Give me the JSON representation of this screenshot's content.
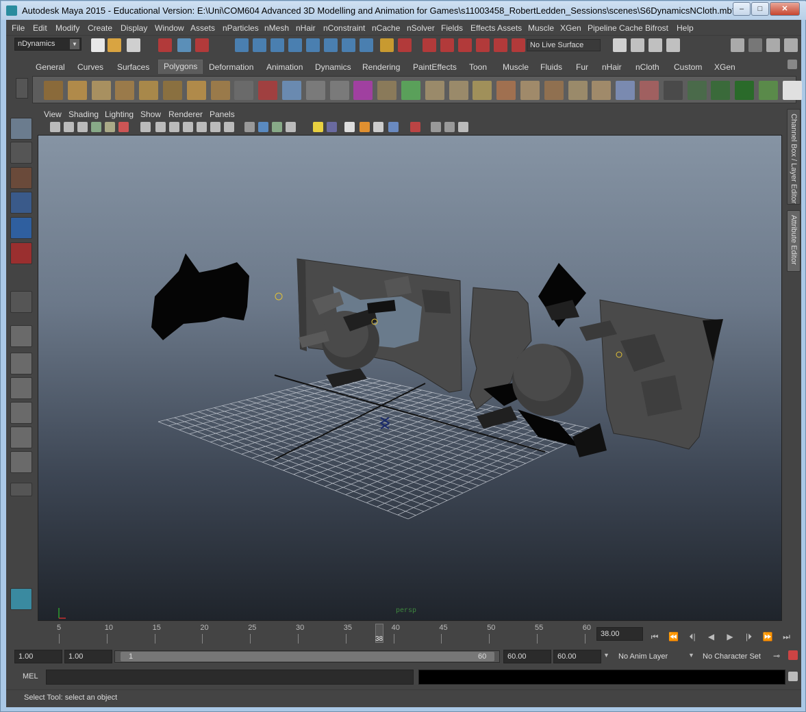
{
  "window": {
    "title": "Autodesk Maya 2015 - Educational Version: E:\\Uni\\COM604 Advanced 3D Modelling and Animation for Games\\s11003458_RobertLedden_Sessions\\scenes\\S6DynamicsNCloth.mb*",
    "minimize": "–",
    "maximize": "□",
    "close": "✕"
  },
  "menubar": {
    "items": [
      "File",
      "Edit",
      "Modify",
      "Create",
      "Display",
      "Window",
      "Assets",
      "nParticles",
      "nMesh",
      "nHair",
      "nConstraint",
      "nCache",
      "nSolver",
      "Fields",
      "Effects Assets",
      "Muscle",
      "XGen",
      "Pipeline Cache",
      "Bifrost",
      "Help"
    ]
  },
  "statusline": {
    "mode": "nDynamics",
    "live_surface": "No Live Surface"
  },
  "shelf": {
    "tabs": [
      "General",
      "Curves",
      "Surfaces",
      "Polygons",
      "Deformation",
      "Animation",
      "Dynamics",
      "Rendering",
      "PaintEffects",
      "Toon",
      "Muscle",
      "Fluids",
      "Fur",
      "nHair",
      "nCloth",
      "Custom",
      "XGen"
    ],
    "active_tab": "Polygons",
    "icons": [
      "poly-sphere-icon",
      "poly-cube-icon",
      "poly-cylinder-icon",
      "poly-cone-icon",
      "poly-plane-icon",
      "poly-torus-icon",
      "poly-pyramid-icon",
      "poly-pipe-icon",
      "poly-soccer-ball-icon",
      "combine-icon",
      "separate-icon",
      "extract-icon",
      "smooth-icon",
      "smooth-proxy-icon",
      "mirror-geometry-icon",
      "mirror-cut-icon",
      "extrude-icon",
      "bridge-icon",
      "append-polygon-icon",
      "insert-edge-loop-icon",
      "split-polygon-icon",
      "merge-vertices-icon",
      "wedge-faces-icon",
      "poke-faces-icon",
      "keep-faces-together-icon",
      "sculpt-geometry-icon",
      "planar-mapping-icon",
      "cylindrical-mapping-icon",
      "spherical-mapping-icon",
      "automatic-mapping-icon",
      "uv-editor-icon",
      "checker-map-icon"
    ]
  },
  "panel": {
    "menu": [
      "View",
      "Shading",
      "Lighting",
      "Show",
      "Renderer",
      "Panels"
    ],
    "camera": "persp"
  },
  "side_tabs": {
    "channel_box": "Channel Box / Layer Editor",
    "attribute_editor": "Attribute Editor"
  },
  "timeline": {
    "ticks": [
      "5",
      "10",
      "15",
      "20",
      "25",
      "30",
      "35",
      "40",
      "45",
      "50",
      "55",
      "60"
    ],
    "current_frame_marker": "38",
    "current_frame_field": "38.00",
    "playback_buttons": [
      "⏮",
      "⏪",
      "⏴|",
      "◀",
      "▶",
      "|⏵",
      "⏩",
      "⏭"
    ]
  },
  "range": {
    "anim_start": "1.00",
    "playback_start": "1.00",
    "slider_start": "1",
    "slider_end": "60",
    "playback_end": "60.00",
    "anim_end": "60.00",
    "anim_layer": "No Anim Layer",
    "character_set": "No Character Set"
  },
  "command": {
    "label": "MEL",
    "help_line": "Select Tool: select an object"
  }
}
